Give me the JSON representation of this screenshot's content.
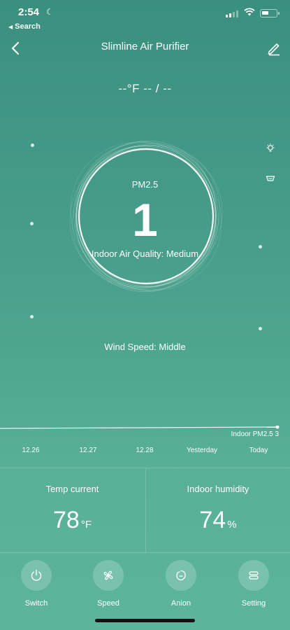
{
  "status_bar": {
    "time": "2:54",
    "back_app": "Search"
  },
  "header": {
    "title": "Slimline Air Purifier"
  },
  "temp_display": "--°F  -- / --",
  "gauge": {
    "label": "PM2.5",
    "value": "1",
    "air_quality": "Indoor Air Quality: Medium"
  },
  "wind_speed": "Wind Speed: Middle",
  "trend": {
    "label": "Indoor PM2.5 3",
    "dates": [
      "12.26",
      "12.27",
      "12.28",
      "Yesterday",
      "Today"
    ]
  },
  "stats": {
    "temp": {
      "title": "Temp current",
      "value": "78",
      "unit": "°F"
    },
    "humidity": {
      "title": "Indoor humidity",
      "value": "74",
      "unit": "%"
    }
  },
  "controls": [
    {
      "label": "Switch",
      "icon": "power-icon"
    },
    {
      "label": "Speed",
      "icon": "fan-icon"
    },
    {
      "label": "Anion",
      "icon": "anion-icon"
    },
    {
      "label": "Setting",
      "icon": "setting-icon"
    }
  ],
  "colors": {
    "background_top": "#3a8f7f",
    "background_bottom": "#5cb49a",
    "text": "#ffffff"
  }
}
